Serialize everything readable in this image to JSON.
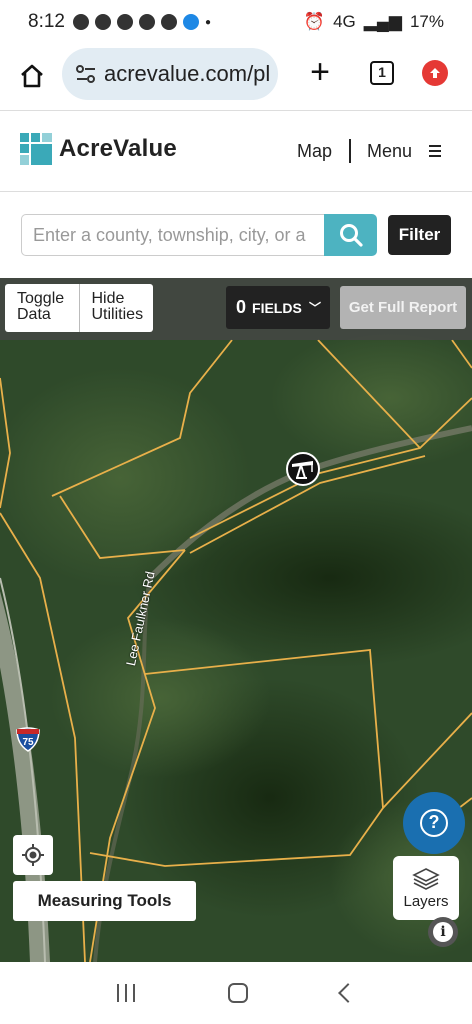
{
  "status_bar": {
    "time": "8:12",
    "network": "4G",
    "battery": "17%"
  },
  "browser": {
    "url": "acrevalue.com/pl",
    "tab_count": "1"
  },
  "header": {
    "brand": "AcreValue",
    "nav_map": "Map",
    "nav_menu": "Menu"
  },
  "search": {
    "placeholder": "Enter a county, township, city, or a",
    "filter_label": "Filter"
  },
  "toolbar": {
    "toggle_data": "Toggle Data",
    "hide_utilities": "Hide Utilities",
    "fields_count": "0",
    "fields_label": "FIELDS",
    "report_label": "Get Full Report"
  },
  "map": {
    "road_name": "Lee Faulkner Rd",
    "highway_shield": "75",
    "measuring_tools": "Measuring Tools",
    "layers_label": "Layers",
    "help_symbol": "?",
    "info_symbol": "i",
    "marker_icon": "oil-pump-icon",
    "colors": {
      "parcel_line": "#e8b04a",
      "help_button": "#1a6fb0",
      "search_button": "#4db3c1"
    }
  }
}
